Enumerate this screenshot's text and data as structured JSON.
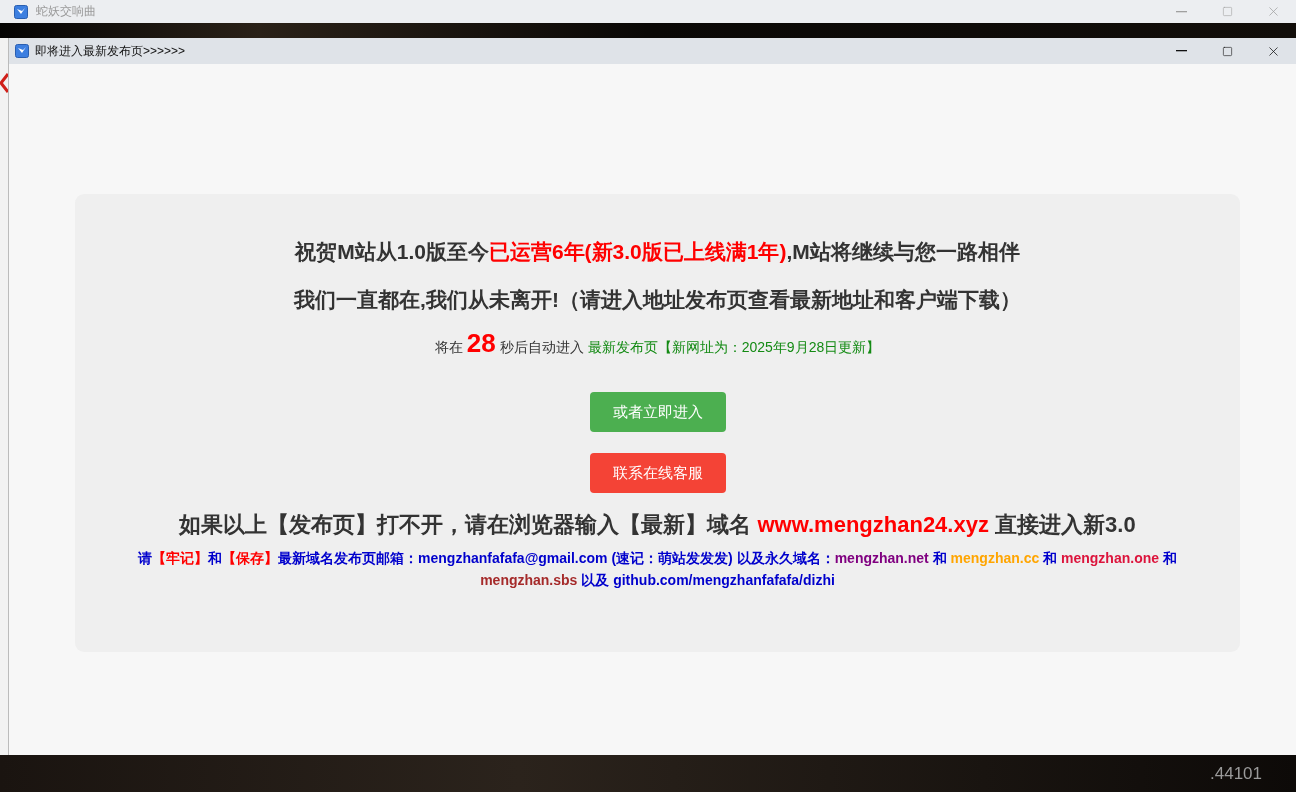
{
  "background_window": {
    "title": "蛇妖交响曲"
  },
  "dialog": {
    "title": "即将进入最新发布页>>>>>>",
    "headline": [
      {
        "text": "祝贺M站从1.0版至今",
        "color": "#333333"
      },
      {
        "text": "已运营6年(新3.0版已上线满1年)",
        "color": "#ff0000"
      },
      {
        "text": ",M站将继续与您一路相伴",
        "color": "#333333"
      }
    ],
    "subheadline": "我们一直都在,我们从未离开!（请进入地址发布页查看最新地址和客户端下载）",
    "countdown": {
      "prefix": "将在",
      "seconds": "28",
      "suffix": "秒后自动进入",
      "link": "最新发布页",
      "note": "【新网址为：2025年9月28日更新】"
    },
    "buttons": [
      {
        "label": "或者立即进入",
        "color": "#4caf50"
      },
      {
        "label": "联系在线客服",
        "color": "#f44336"
      }
    ],
    "fallback": [
      {
        "text": "如果以上【发布页】打不开，请在浏览器输入【最新】域名 ",
        "color": "#333333"
      },
      {
        "text": "www.mengzhan24.xyz",
        "color": "#ff0000"
      },
      {
        "text": " 直接进入新3.0",
        "color": "#333333"
      }
    ],
    "notice": [
      {
        "text": "请",
        "color": "#0000cc"
      },
      {
        "text": "【牢记】",
        "color": "#ff0000"
      },
      {
        "text": "和",
        "color": "#0000cc"
      },
      {
        "text": "【保存】",
        "color": "#ff0000"
      },
      {
        "text": "最新域名发布页邮箱：mengzhanfafafa@gmail.com (速记：萌站发发发) 以及永久域名：",
        "color": "#0000cc"
      },
      {
        "text": "mengzhan.net",
        "color": "#800080"
      },
      {
        "text": " 和 ",
        "color": "#0000cc"
      },
      {
        "text": "mengzhan.cc",
        "color": "#ffa500"
      },
      {
        "text": " 和 ",
        "color": "#0000cc"
      },
      {
        "text": "mengzhan.one",
        "color": "#dc143c"
      },
      {
        "text": " 和 ",
        "color": "#0000cc"
      },
      {
        "text": "mengzhan.sbs",
        "color": "#a52a2a"
      },
      {
        "text": " 以及 github.com/mengzhanfafafa/dizhi",
        "color": "#0000cc"
      }
    ]
  },
  "background_text": ".44101"
}
